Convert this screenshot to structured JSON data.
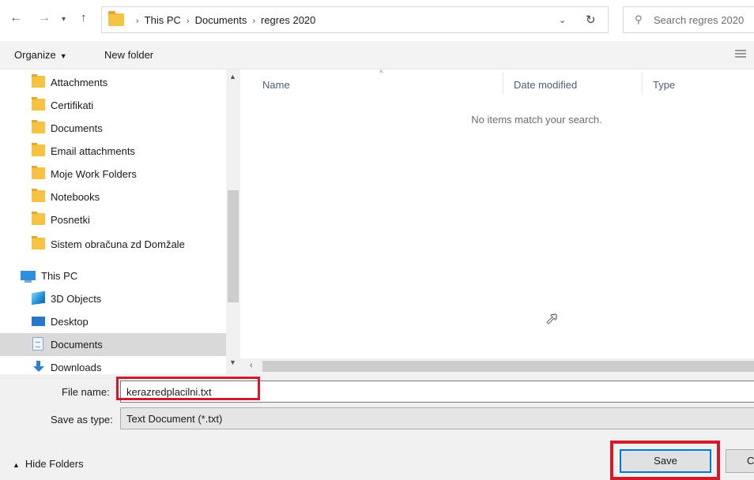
{
  "address": {
    "breadcrumbs": [
      "This PC",
      "Documents",
      "regres 2020"
    ],
    "search_placeholder": "Search regres 2020"
  },
  "toolbar": {
    "organize_label": "Organize",
    "new_folder_label": "New folder"
  },
  "nav_pane": {
    "items": [
      {
        "label": "Attachments",
        "icon": "folder-icon"
      },
      {
        "label": "Certifikati",
        "icon": "folder-icon"
      },
      {
        "label": "Documents",
        "icon": "folder-icon"
      },
      {
        "label": "Email attachments",
        "icon": "folder-icon"
      },
      {
        "label": "Moje Work Folders",
        "icon": "folder-icon"
      },
      {
        "label": "Notebooks",
        "icon": "folder-icon"
      },
      {
        "label": "Posnetki",
        "icon": "folder-icon"
      },
      {
        "label": "Sistem obračuna zd Domžale",
        "icon": "folder-icon"
      },
      {
        "label": "This PC",
        "icon": "computer-icon"
      },
      {
        "label": "3D Objects",
        "icon": "3d-objects-icon"
      },
      {
        "label": "Desktop",
        "icon": "desktop-icon"
      },
      {
        "label": "Documents",
        "icon": "documents-icon",
        "selected": true
      },
      {
        "label": "Downloads",
        "icon": "downloads-icon"
      }
    ]
  },
  "file_list": {
    "columns": [
      "Name",
      "Date modified",
      "Type"
    ],
    "empty_message": "No items match your search."
  },
  "form": {
    "file_name_label": "File name:",
    "file_name_value": "kerazredplacilni.txt",
    "save_as_type_label": "Save as type:",
    "save_as_type_value": "Text Document (*.txt)",
    "hide_folders_label": "Hide Folders",
    "save_label": "Save",
    "cancel_label": "Cancel"
  },
  "colors": {
    "highlight": "#d11a2a",
    "focus_border": "#0078d7",
    "folder": "#f6c244"
  }
}
